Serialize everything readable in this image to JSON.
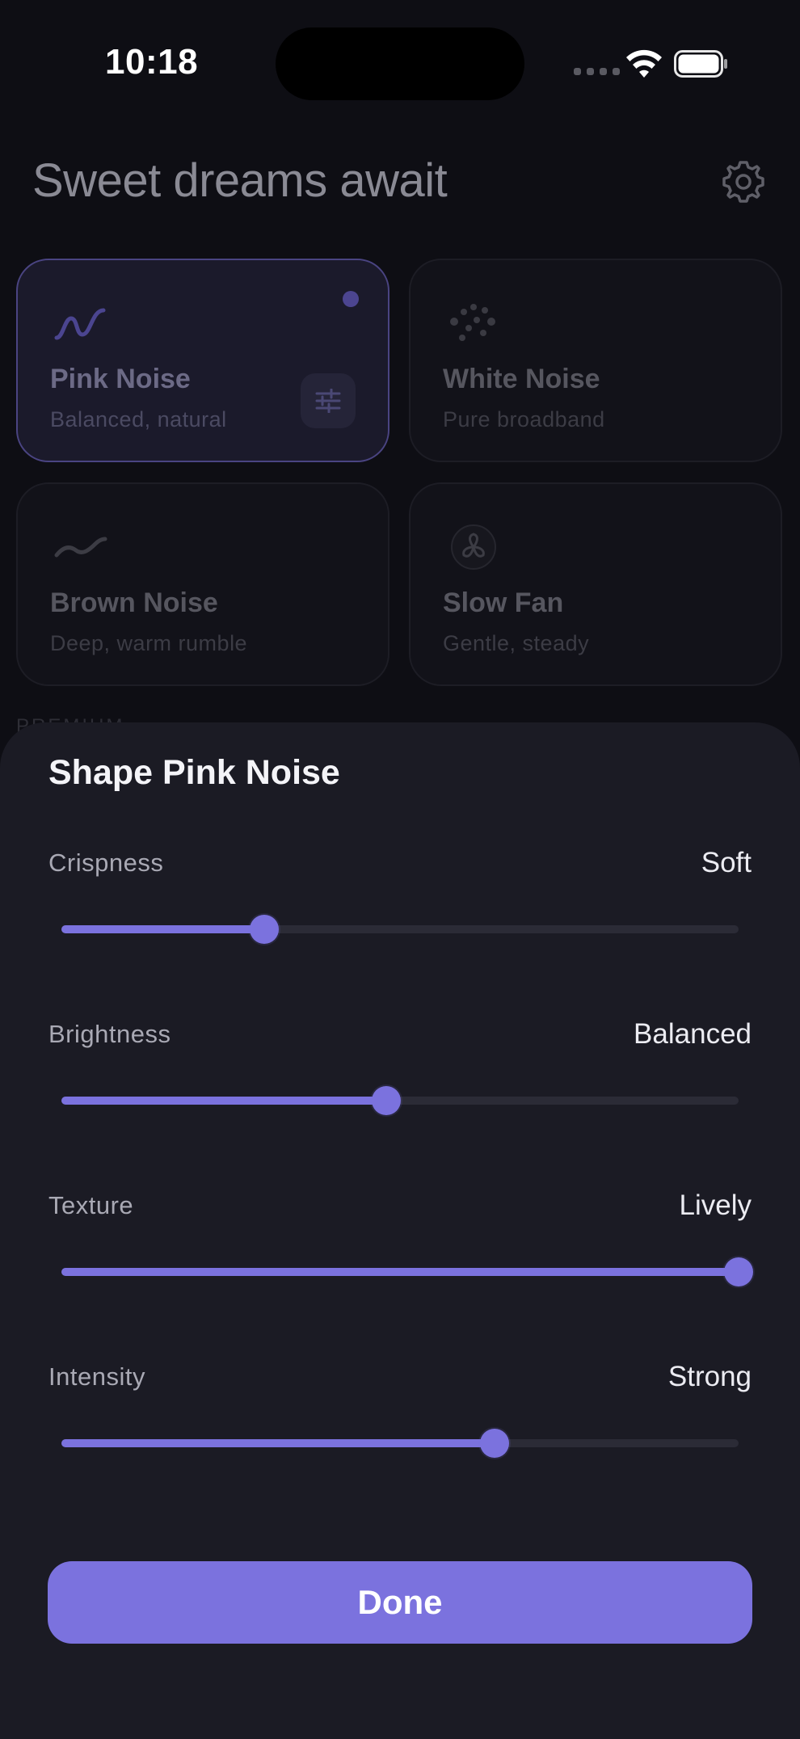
{
  "status_bar": {
    "time": "10:18"
  },
  "header": {
    "title": "Sweet dreams await"
  },
  "sounds": [
    {
      "title": "Pink Noise",
      "subtitle": "Balanced, natural",
      "icon": "wave-icon",
      "active": true
    },
    {
      "title": "White Noise",
      "subtitle": "Pure broadband",
      "icon": "dots-icon",
      "active": false
    },
    {
      "title": "Brown Noise",
      "subtitle": "Deep, warm rumble",
      "icon": "curve-icon",
      "active": false
    },
    {
      "title": "Slow Fan",
      "subtitle": "Gentle, steady",
      "icon": "fan-icon",
      "active": false
    }
  ],
  "section_peek": "PREMIUM",
  "sheet": {
    "title": "Shape Pink Noise",
    "sliders": [
      {
        "label": "Crispness",
        "value_label": "Soft",
        "level": 0.3
      },
      {
        "label": "Brightness",
        "value_label": "Balanced",
        "level": 0.48
      },
      {
        "label": "Texture",
        "value_label": "Lively",
        "level": 1.0
      },
      {
        "label": "Intensity",
        "value_label": "Strong",
        "level": 0.64
      }
    ],
    "done_label": "Done"
  },
  "colors": {
    "accent": "#7b72de",
    "sheet_bg": "#1b1b24",
    "active_card_border": "#4a4482"
  }
}
